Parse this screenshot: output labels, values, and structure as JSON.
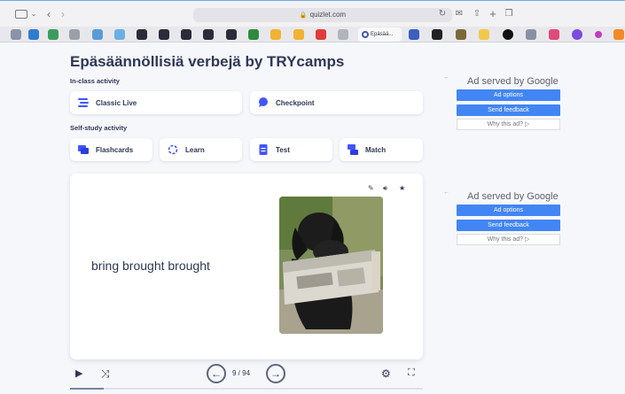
{
  "browser": {
    "url": "quizlet.com",
    "active_tab_label": "Epäsää..."
  },
  "page": {
    "title": "Epäsäännöllisiä verbejä by TRYcamps",
    "in_class_heading": "In-class activity",
    "self_study_heading": "Self-study activity",
    "in_class": [
      {
        "label": "Classic Live",
        "icon": "lines-icon",
        "color": "#4255ff"
      },
      {
        "label": "Checkpoint",
        "icon": "chat-bubble-icon",
        "color": "#4255ff"
      }
    ],
    "self_study": [
      {
        "label": "Flashcards",
        "icon": "cards-icon",
        "color": "#4255ff"
      },
      {
        "label": "Learn",
        "icon": "cycle-icon",
        "color": "#4255ff"
      },
      {
        "label": "Test",
        "icon": "document-icon",
        "color": "#4255ff"
      },
      {
        "label": "Match",
        "icon": "match-icon",
        "color": "#4255ff"
      }
    ]
  },
  "flashcard": {
    "term": "bring brought brought",
    "image_icon": "dog-newspaper-image"
  },
  "controls": {
    "counter": "9 / 94",
    "progress": 0.0957
  },
  "ads": [
    {
      "title": "Ad served by Google",
      "options": "Ad options",
      "feedback": "Send feedback",
      "why": "Why this ad? ▷"
    },
    {
      "title": "Ad served by Google",
      "options": "Ad options",
      "feedback": "Send feedback",
      "why": "Why this ad? ▷"
    }
  ]
}
